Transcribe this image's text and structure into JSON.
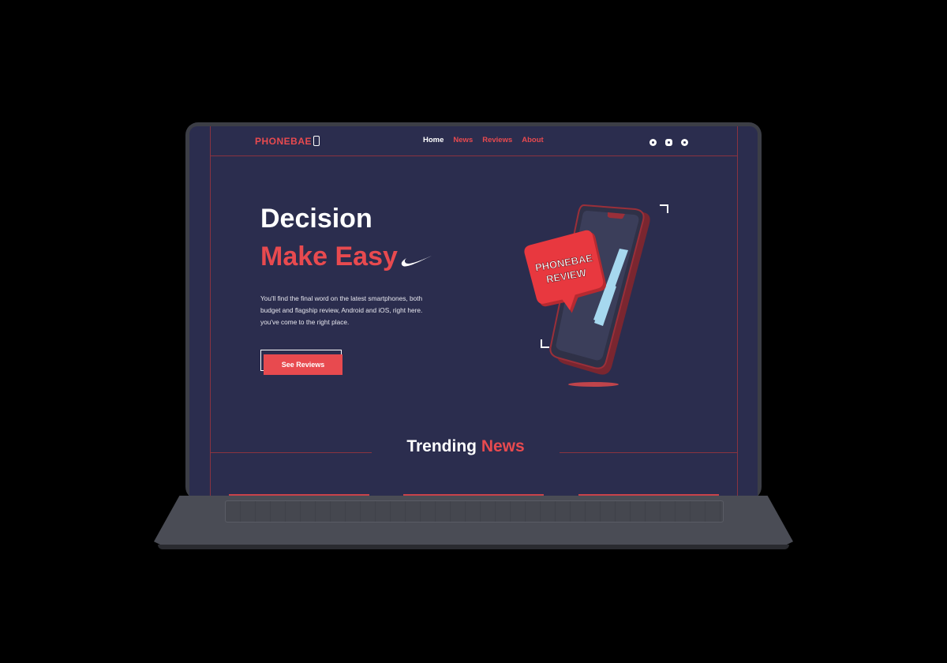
{
  "site": {
    "logo": "PHONEBAE",
    "nav": [
      "Home",
      "News",
      "Reviews",
      "About"
    ],
    "active_nav": "Home",
    "social_icons": [
      "facebook-icon",
      "instagram-icon",
      "twitter-icon"
    ]
  },
  "hero": {
    "title_line1": "Decision",
    "title_line2": "Make Easy",
    "description": "You'll find the final word on the latest smartphones, both budget and flagship review, Android and iOS, right here. you've come to the right place.",
    "cta": "See Reviews",
    "badge_text": [
      "PHONEBAE",
      "REVIEW"
    ]
  },
  "trending": {
    "title_white": "Trending",
    "title_red": "News"
  },
  "colors": {
    "background": "#2b2d4e",
    "accent": "#e84a4f",
    "text": "#ffffff",
    "frame": "#3c3e46"
  }
}
